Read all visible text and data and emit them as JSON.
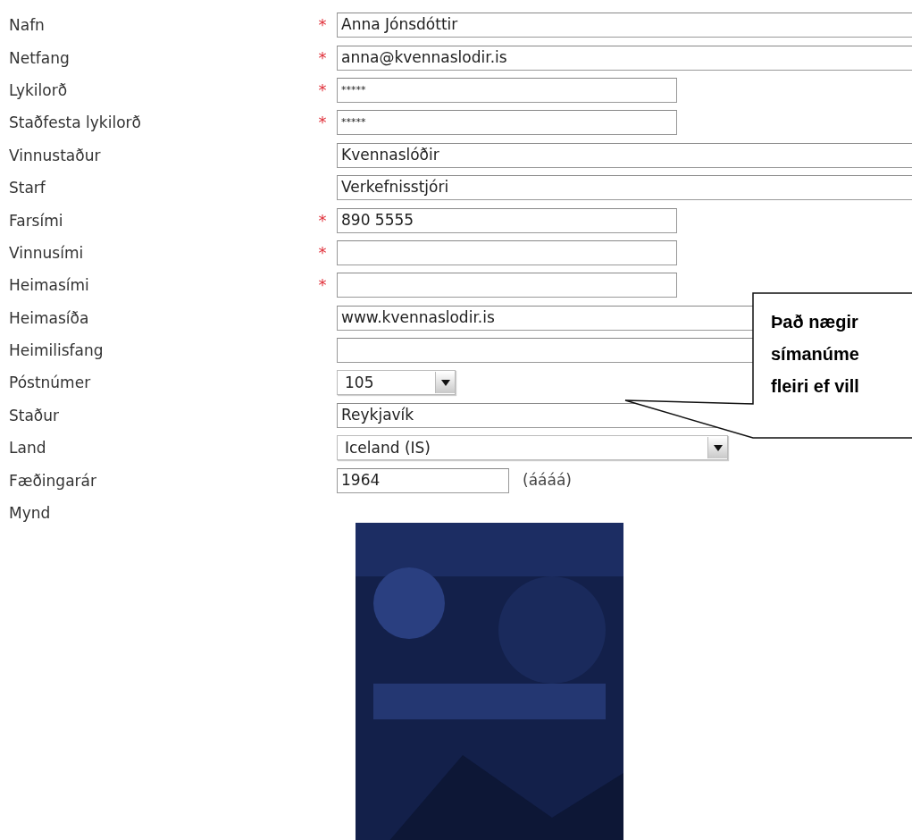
{
  "form": {
    "rows": [
      {
        "label": "Nafn",
        "marker": "*",
        "kind": "long-field",
        "value": "Anna Jónsdóttir"
      },
      {
        "label": "Netfang",
        "marker": "*",
        "kind": "long-field",
        "value": "anna@kvennaslodir.is"
      },
      {
        "label": "Lykilorð",
        "marker": "*",
        "kind": "password-field",
        "value": "*****"
      },
      {
        "label": "Staðfesta lykilorð",
        "marker": "*",
        "kind": "password-field",
        "value": "*****"
      },
      {
        "label": "Vinnustaður",
        "kind": "long-field",
        "value": "Kvennaslóðir"
      },
      {
        "label": "Starf",
        "kind": "long-field",
        "value": "Verkefnisstjóri"
      },
      {
        "label": "Farsími",
        "marker": "*",
        "kind": "short-field",
        "value": "890 5555"
      },
      {
        "label": "Vinnusími",
        "marker": "*",
        "kind": "short-field"
      },
      {
        "label": "Heimasími",
        "marker": "*",
        "kind": "short-field"
      },
      {
        "label": "Heimasíða",
        "kind": "long-field",
        "value": "www.kvennaslodir.is"
      },
      {
        "label": "Heimilisfang",
        "kind": "long-field"
      },
      {
        "label": "Póstnúmer",
        "kind": "small-select",
        "value": "105"
      },
      {
        "label": "Staður",
        "kind": "long-field",
        "value": "Reykjavík"
      },
      {
        "label": "Land",
        "kind": "wide-select",
        "value": "Iceland (IS)"
      },
      {
        "label": "Fæðingarár",
        "kind": "year-field",
        "value": "1964",
        "note": "(áááá)"
      },
      {
        "label": "Mynd",
        "kind": "picture"
      }
    ]
  },
  "callout": {
    "lines": [
      "Það nægir",
      "símanúme",
      "fleiri ef vill"
    ]
  }
}
